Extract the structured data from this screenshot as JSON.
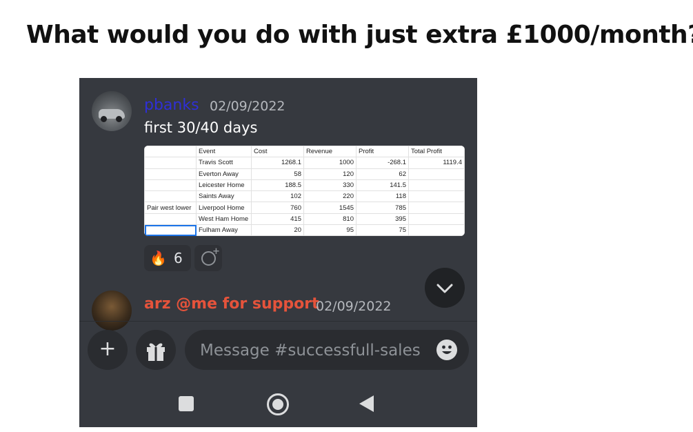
{
  "headline": "What would you do with just extra £1000/month?",
  "messages": [
    {
      "username": "pbanks",
      "timestamp": "02/09/2022",
      "text": "first 30/40 days"
    },
    {
      "username": "arz @me for support",
      "timestamp": "02/09/2022"
    }
  ],
  "sheet": {
    "headers": [
      "",
      "Event",
      "Cost",
      "Revenue",
      "Profit",
      "Total Profit"
    ],
    "rows": [
      [
        "",
        "Travis Scott",
        "1268.1",
        "1000",
        "-268.1",
        "1119.4"
      ],
      [
        "",
        "Everton Away",
        "58",
        "120",
        "62",
        ""
      ],
      [
        "",
        "Leicester Home",
        "188.5",
        "330",
        "141.5",
        ""
      ],
      [
        "",
        "Saints Away",
        "102",
        "220",
        "118",
        ""
      ],
      [
        "Pair west lower",
        "Liverpool Home",
        "760",
        "1545",
        "785",
        ""
      ],
      [
        "",
        "West Ham Home",
        "415",
        "810",
        "395",
        ""
      ],
      [
        "",
        "Fulham Away",
        "20",
        "95",
        "75",
        ""
      ]
    ]
  },
  "reaction": {
    "emoji": "🔥",
    "count": "6"
  },
  "composer": {
    "placeholder": "Message #successfull-sales"
  },
  "icons": {
    "scroll_down": "chevron-down-icon",
    "plus": "plus-icon",
    "gift": "gift-icon",
    "emoji": "smiley-icon",
    "add_reaction": "add-reaction-icon",
    "nav_recent": "square-icon",
    "nav_home": "home-circle-icon",
    "nav_back": "back-triangle-icon"
  },
  "colors": {
    "background": "#36393f",
    "username1": "#2f2fd6",
    "username2": "#e5533b",
    "timestamp": "#b5b8bd"
  }
}
